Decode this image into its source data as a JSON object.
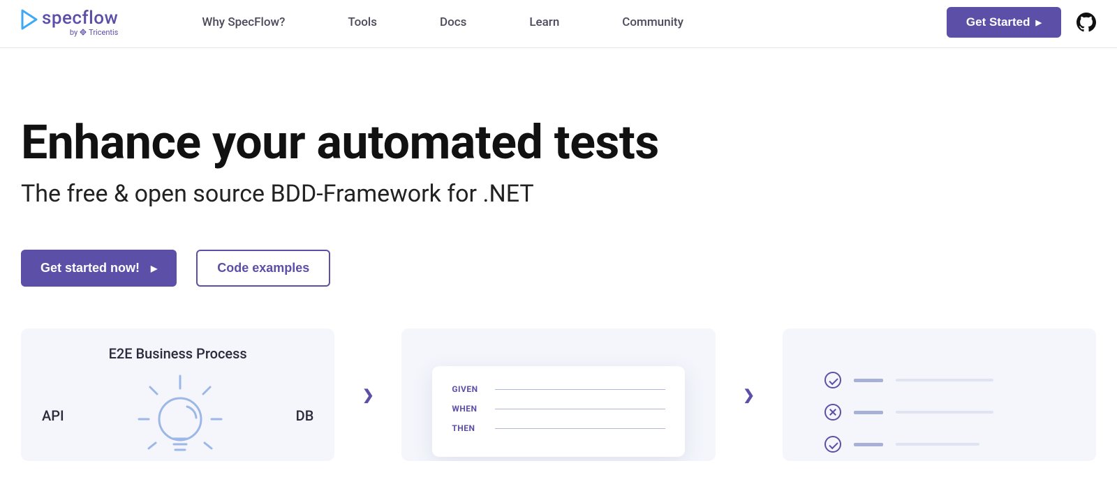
{
  "brand": {
    "name": "specflow",
    "byline_prefix": "by",
    "byline_company": "Tricentis"
  },
  "nav": {
    "items": [
      {
        "label": "Why SpecFlow?"
      },
      {
        "label": "Tools"
      },
      {
        "label": "Docs"
      },
      {
        "label": "Learn"
      },
      {
        "label": "Community"
      }
    ]
  },
  "header": {
    "cta": "Get Started"
  },
  "hero": {
    "title": "Enhance your automated tests",
    "subtitle": "The free & open source BDD-Framework for .NET",
    "primary_cta": "Get started now!",
    "secondary_cta": "Code examples"
  },
  "cards": {
    "card1": {
      "title": "E2E Business Process",
      "left_label": "API",
      "right_label": "DB"
    },
    "card2": {
      "keywords": [
        "GIVEN",
        "WHEN",
        "THEN"
      ]
    },
    "card3": {
      "rows": [
        {
          "status": "pass"
        },
        {
          "status": "fail"
        },
        {
          "status": "pass"
        }
      ]
    }
  }
}
